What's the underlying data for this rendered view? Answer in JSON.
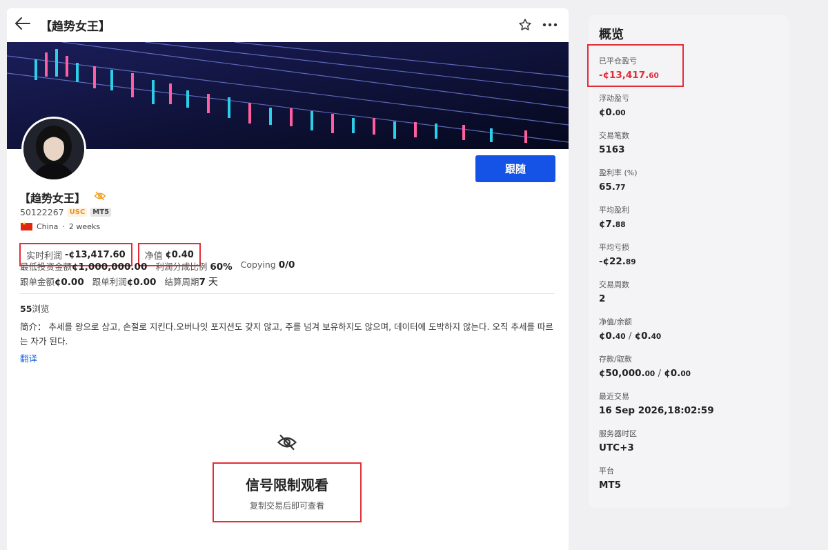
{
  "header": {
    "title": "【趋势女王】",
    "back_icon": "arrow-left-icon",
    "star_icon": "star-icon",
    "more_icon": "more-icon"
  },
  "profile": {
    "name": "【趋势女王】",
    "account_id": "50122267",
    "badge_currency": "USC",
    "badge_platform": "MT5",
    "country": "China",
    "age": "2 weeks",
    "follow_label": "跟随"
  },
  "stats": {
    "realtime_profit_label": "实时利润",
    "realtime_profit_value": "-¢13,417.60",
    "equity_label": "净值",
    "equity_value": "¢0.40",
    "min_invest_label": "最低投资金额",
    "min_invest_value": "¢1,000,000.00",
    "profit_share_label": "利润分成比例",
    "profit_share_value": "60%",
    "copying_label": "Copying",
    "copying_value": "0/0",
    "follow_amount_label": "跟单金额",
    "follow_amount_value": "¢0.00",
    "follow_profit_label": "跟单利润",
    "follow_profit_value": "¢0.00",
    "settle_label": "结算周期",
    "settle_value": "7",
    "settle_unit": "天"
  },
  "views": {
    "count": "55",
    "label": "浏览"
  },
  "intro": {
    "label": "简介：",
    "text": "추세를 왕으로 삼고, 손절로 지킨다.오버나잇 포지션도 갖지 않고, 주를 넘겨 보유하지도 않으며, 데이터에 도박하지 않는다. 오직 추세를 따르는 자가 된다.",
    "translate": "翻译"
  },
  "restricted": {
    "title": "信号限制观看",
    "subtitle": "复制交易后即可查看"
  },
  "overview": {
    "title": "概览",
    "closed_pnl": {
      "label": "已平仓盈亏",
      "main": "-¢13,417.",
      "dec": "60"
    },
    "floating_pnl": {
      "label": "浮动盈亏",
      "main": "¢0.",
      "dec": "00"
    },
    "trades": {
      "label": "交易笔数",
      "value": "5163"
    },
    "win_rate": {
      "label": "盈利率 (%)",
      "main": "65.",
      "dec": "77"
    },
    "avg_profit": {
      "label": "平均盈利",
      "main": "¢7.",
      "dec": "88"
    },
    "avg_loss": {
      "label": "平均亏损",
      "main": "-¢22.",
      "dec": "89"
    },
    "weeks": {
      "label": "交易周数",
      "value": "2"
    },
    "equity_balance": {
      "label": "净值/余额",
      "a_main": "¢0.",
      "a_dec": "40",
      "sep": " / ",
      "b_main": "¢0.",
      "b_dec": "40"
    },
    "deposit_withdraw": {
      "label": "存款/取款",
      "a_main": "¢50,000.",
      "a_dec": "00",
      "sep": " / ",
      "b_main": "¢0.",
      "b_dec": "00"
    },
    "last_trade": {
      "label": "最近交易",
      "value": "16 Sep 2026,18:02:59"
    },
    "server_tz": {
      "label": "服务器时区",
      "value": "UTC+3"
    },
    "platform": {
      "label": "平台",
      "value": "MT5"
    }
  },
  "colors": {
    "accent": "#1453e6",
    "loss": "#e22d36",
    "highlight_border": "#e22d36",
    "usc_badge": "#e89420"
  }
}
